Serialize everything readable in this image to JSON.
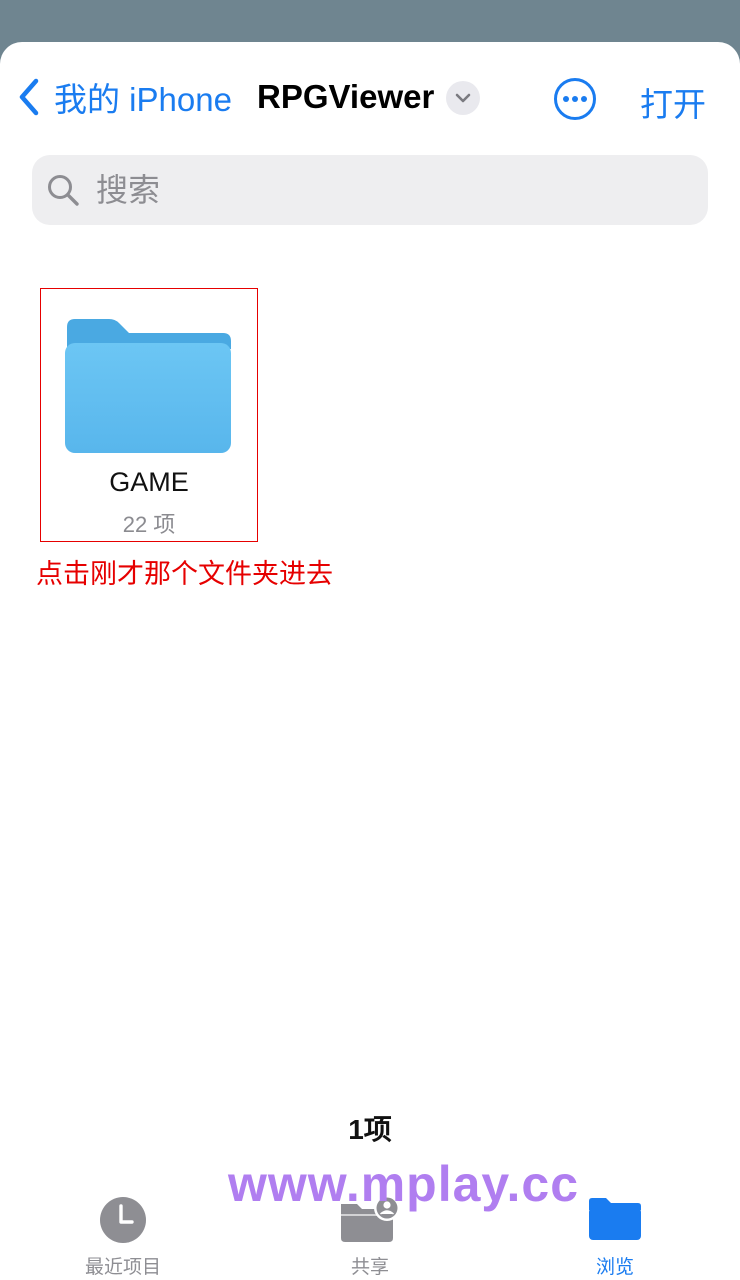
{
  "nav": {
    "back_label": "我的 iPhone",
    "title": "RPGViewer",
    "open_label": "打开"
  },
  "search": {
    "placeholder": "搜索"
  },
  "folder": {
    "name": "GAME",
    "count": "22 项"
  },
  "annotation": "点击刚才那个文件夹进去",
  "footer": {
    "item_count": "1项"
  },
  "watermark": "www.mplay.cc",
  "tabs": [
    {
      "label": "最近项目",
      "icon": "clock-icon"
    },
    {
      "label": "共享",
      "icon": "shared-folder-icon"
    },
    {
      "label": "浏览",
      "icon": "folder-icon",
      "active": true
    }
  ],
  "colors": {
    "accent": "#1a7cf0",
    "annotation": "#e60000",
    "watermark": "#b07ef0",
    "folder": "#5ab8ee"
  }
}
